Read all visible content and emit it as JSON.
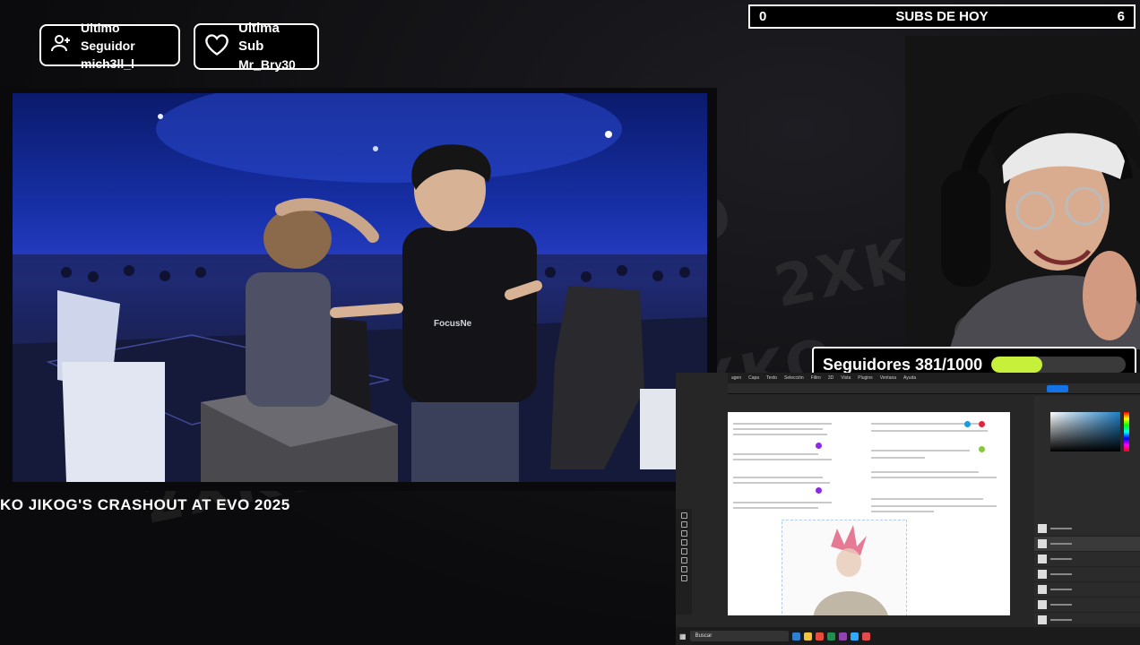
{
  "alerts": {
    "follower": {
      "label": "Ultimo Seguidor",
      "name": "mich3ll_l"
    },
    "sub": {
      "label": "Ultima Sub",
      "name": "Mr_Bry30"
    }
  },
  "subs_today": {
    "left": "0",
    "title": "SUBS DE HOY",
    "right": "6"
  },
  "ticker": {
    "text": "KO JIKOG'S CRASHOUT AT EVO 2025"
  },
  "followers_goal": {
    "label": "Seguidores 381/1000",
    "progress": 0.381,
    "color": "#c7f03a"
  },
  "photoshop": {
    "menu": [
      "agen",
      "Capa",
      "Texto",
      "Selección",
      "Filtro",
      "3D",
      "Vista",
      "Plugins",
      "Ventana",
      "Ayuda"
    ],
    "taskbar_search": "Buscar"
  },
  "background_logo": "2XKO"
}
